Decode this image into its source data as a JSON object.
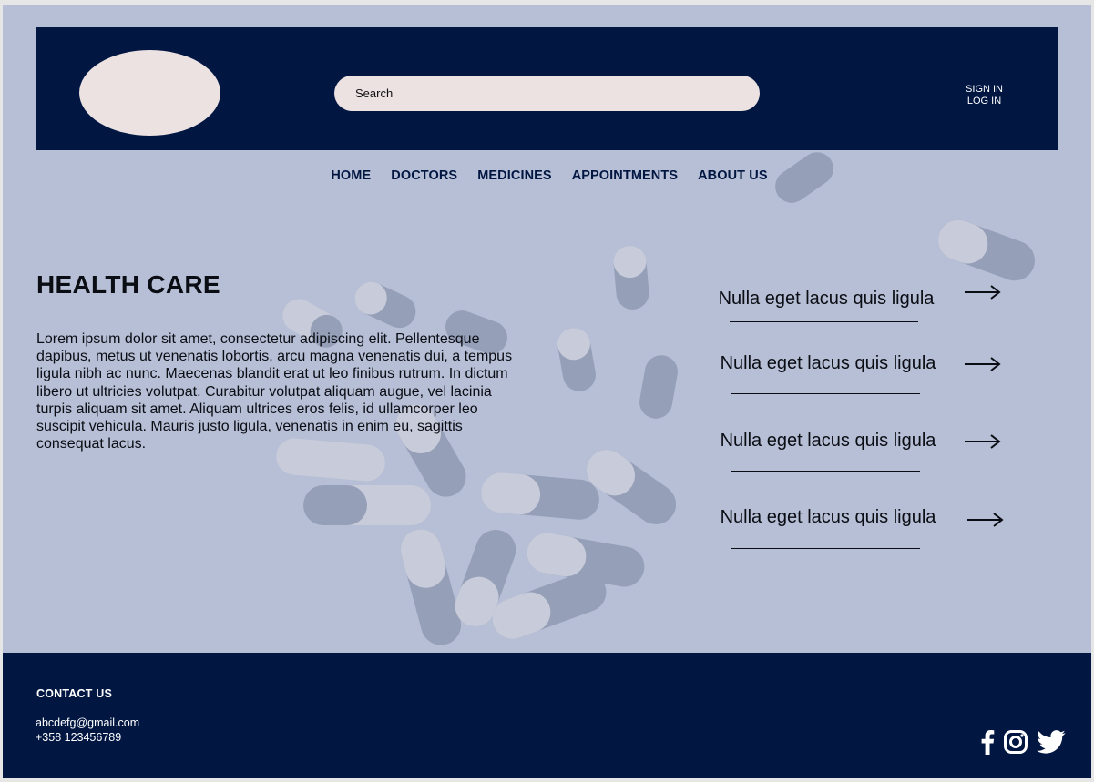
{
  "header": {
    "search_placeholder": "Search",
    "sign_in": "SIGN IN",
    "log_in": "LOG IN"
  },
  "nav": {
    "items": [
      "HOME",
      "DOCTORS",
      "MEDICINES",
      "APPOINTMENTS",
      "ABOUT US"
    ]
  },
  "hero": {
    "title": "HEALTH CARE",
    "body": "Lorem ipsum dolor sit amet, consectetur adipiscing elit. Pellentesque dapibus, metus ut venenatis lobortis, arcu magna venenatis dui, a tempus ligula nibh ac nunc. Maecenas blandit erat ut leo finibus rutrum. In dictum libero ut ultricies volutpat. Curabitur volutpat aliquam augue, vel lacinia turpis aliquam sit amet. Aliquam ultrices eros felis, id ullamcorper leo suscipit vehicula. Mauris justo ligula, venenatis in enim eu, sagittis consequat lacus."
  },
  "links": [
    {
      "label": "Nulla eget lacus quis ligula"
    },
    {
      "label": "Nulla eget lacus quis ligula"
    },
    {
      "label": "Nulla eget lacus quis ligula"
    },
    {
      "label": "Nulla eget lacus quis ligula"
    }
  ],
  "footer": {
    "contact_title": "CONTACT US",
    "email": "abcdefg@gmail.com",
    "phone": "+358 123456789",
    "social": [
      "facebook-icon",
      "instagram-icon",
      "twitter-icon"
    ]
  },
  "colors": {
    "navy": "#021642",
    "background": "#b6bfd5",
    "logo_fill": "#ebe2e1"
  }
}
